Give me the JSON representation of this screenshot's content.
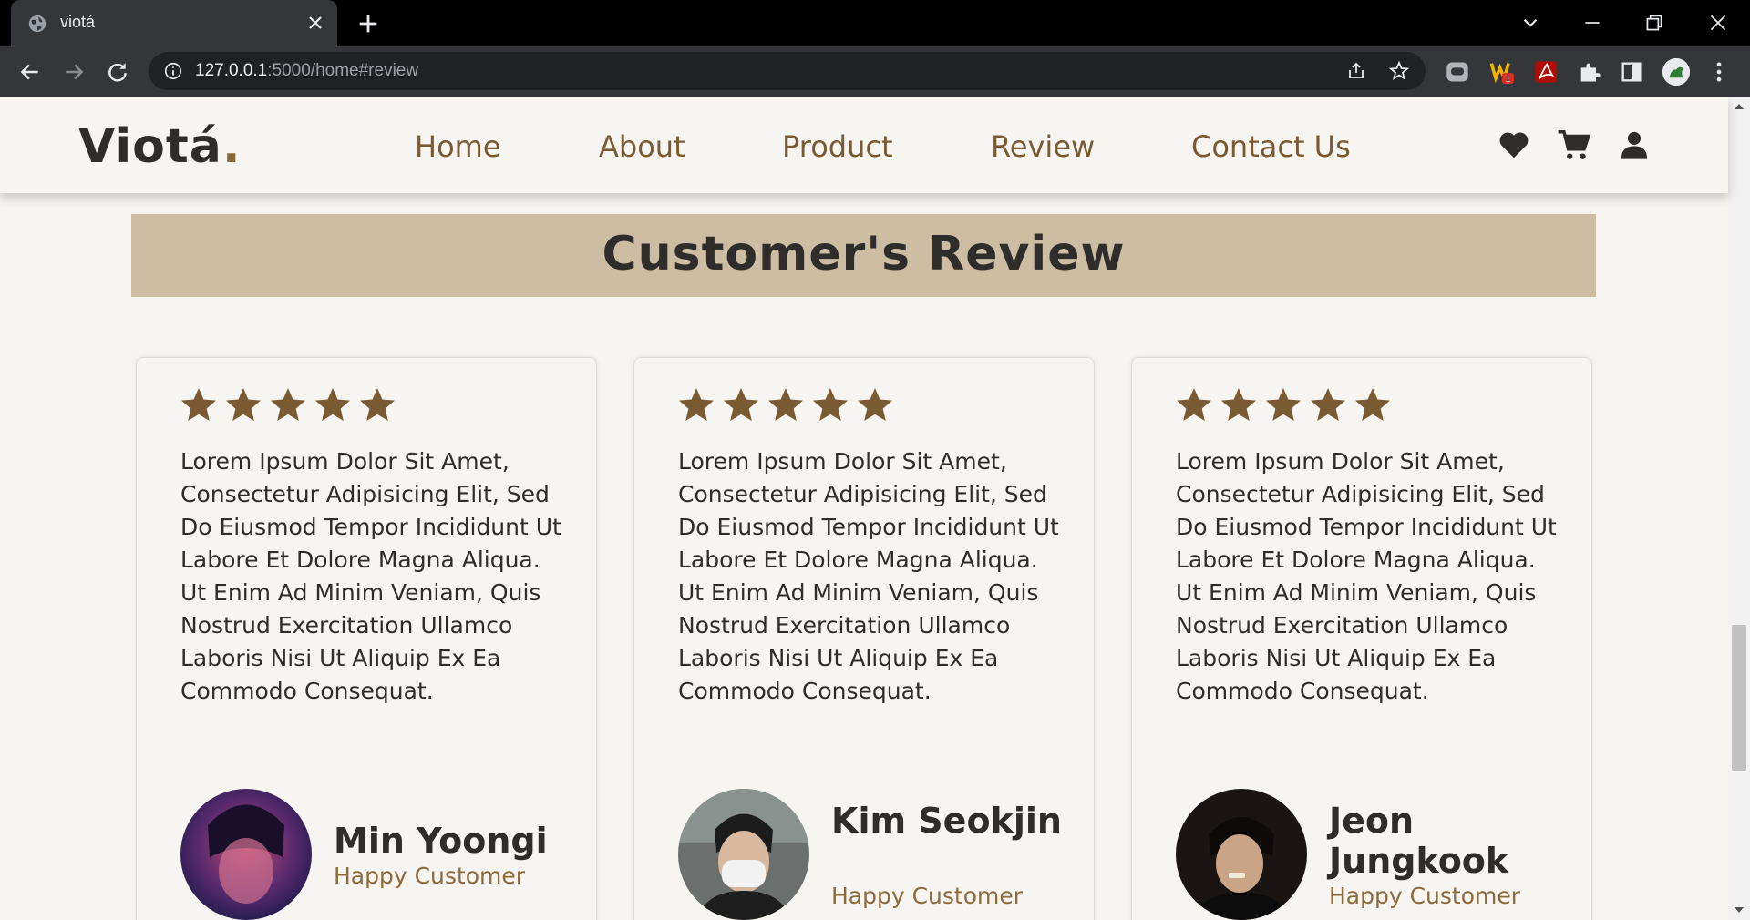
{
  "browser": {
    "tab_title": "viotá",
    "url_host": "127.0.0.1",
    "url_path": ":5000/home#review"
  },
  "site": {
    "logo_text": "Viotá",
    "logo_dot": ".",
    "nav": [
      "Home",
      "About",
      "Product",
      "Review",
      "Contact Us"
    ],
    "header_icons": [
      "heart-icon",
      "cart-icon",
      "user-icon"
    ]
  },
  "review_section": {
    "title": "Customer's Review",
    "cards": [
      {
        "rating": 5,
        "text": "Lorem Ipsum Dolor Sit Amet, Consectetur Adipisicing Elit, Sed Do Eiusmod Tempor Incididunt Ut Labore Et Dolore Magna Aliqua. Ut Enim Ad Minim Veniam, Quis Nostrud Exercitation Ullamco Laboris Nisi Ut Aliquip Ex Ea Commodo Consequat.",
        "name": "Min Yoongi",
        "role": "Happy Customer"
      },
      {
        "rating": 5,
        "text": "Lorem Ipsum Dolor Sit Amet, Consectetur Adipisicing Elit, Sed Do Eiusmod Tempor Incididunt Ut Labore Et Dolore Magna Aliqua. Ut Enim Ad Minim Veniam, Quis Nostrud Exercitation Ullamco Laboris Nisi Ut Aliquip Ex Ea Commodo Consequat.",
        "name": "Kim Seokjin",
        "role": "Happy Customer"
      },
      {
        "rating": 5,
        "text": "Lorem Ipsum Dolor Sit Amet, Consectetur Adipisicing Elit, Sed Do Eiusmod Tempor Incididunt Ut Labore Et Dolore Magna Aliqua. Ut Enim Ad Minim Veniam, Quis Nostrud Exercitation Ullamco Laboris Nisi Ut Aliquip Ex Ea Commodo Consequat.",
        "name": "Jeon Jungkook",
        "role": "Happy Customer"
      }
    ]
  },
  "colors": {
    "accent_brown": "#8d6a3c",
    "star": "#7a5a33",
    "banner": "#cdbda3",
    "page_bg": "#f7f5f1"
  }
}
